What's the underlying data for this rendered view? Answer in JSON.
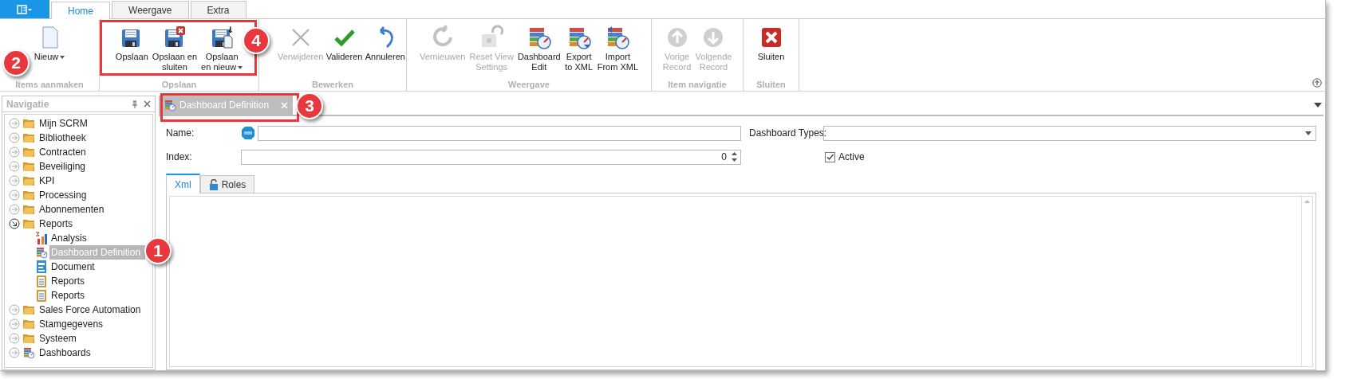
{
  "ribbon_tabs": [
    {
      "label": "Home",
      "selected": true
    },
    {
      "label": "Weergave",
      "selected": false
    },
    {
      "label": "Extra",
      "selected": false
    }
  ],
  "ribbon_groups": [
    {
      "label": "Items aanmaken",
      "buttons": [
        {
          "label": "Nieuw",
          "kind": "new",
          "disabled": false,
          "dropdown": true
        }
      ]
    },
    {
      "label": "Opslaan",
      "buttons": [
        {
          "label": "Opslaan",
          "kind": "save",
          "disabled": false,
          "dropdown": false
        },
        {
          "label": "Opslaan en\nsluiten",
          "kind": "save_close",
          "disabled": false,
          "dropdown": false
        },
        {
          "label": "Opslaan\nen nieuw",
          "kind": "save_new",
          "disabled": false,
          "dropdown": true
        }
      ]
    },
    {
      "label": "Bewerken",
      "buttons": [
        {
          "label": "Verwijderen",
          "kind": "delete",
          "disabled": true,
          "dropdown": false
        },
        {
          "label": "Valideren",
          "kind": "validate",
          "disabled": false,
          "dropdown": false
        },
        {
          "label": "Annuleren",
          "kind": "undo",
          "disabled": false,
          "dropdown": false
        }
      ]
    },
    {
      "label": "Weergave",
      "buttons": [
        {
          "label": "Vernieuwen",
          "kind": "refresh",
          "disabled": true,
          "dropdown": false
        },
        {
          "label": "Reset View\nSettings",
          "kind": "reset",
          "disabled": true,
          "dropdown": false
        },
        {
          "label": "Dashboard\nEdit",
          "kind": "dashboard",
          "disabled": false,
          "dropdown": false
        },
        {
          "label": "Export\nto XML",
          "kind": "export",
          "disabled": false,
          "dropdown": false
        },
        {
          "label": "Import\nFrom XML",
          "kind": "import",
          "disabled": false,
          "dropdown": false
        }
      ]
    },
    {
      "label": "Item navigatie",
      "buttons": [
        {
          "label": "Vorige\nRecord",
          "kind": "up",
          "disabled": true,
          "dropdown": false
        },
        {
          "label": "Volgende\nRecord",
          "kind": "down",
          "disabled": true,
          "dropdown": false
        }
      ]
    },
    {
      "label": "Sluiten",
      "buttons": [
        {
          "label": "Sluiten",
          "kind": "close",
          "disabled": false,
          "dropdown": false
        }
      ]
    }
  ],
  "navigation": {
    "title": "Navigatie",
    "items": [
      {
        "label": "Mijn SCRM",
        "kind": "folder",
        "expanded": false
      },
      {
        "label": "Bibliotheek",
        "kind": "folder",
        "expanded": false
      },
      {
        "label": "Contracten",
        "kind": "folder",
        "expanded": false
      },
      {
        "label": "Beveiliging",
        "kind": "folder",
        "expanded": false
      },
      {
        "label": "KPI",
        "kind": "folder",
        "expanded": false
      },
      {
        "label": "Processing",
        "kind": "folder",
        "expanded": false
      },
      {
        "label": "Abonnementen",
        "kind": "folder",
        "expanded": false
      },
      {
        "label": "Reports",
        "kind": "folder",
        "expanded": true,
        "children": [
          {
            "label": "Analysis",
            "kind": "chart",
            "selected": false
          },
          {
            "label": "Dashboard Definition",
            "kind": "dashboard",
            "selected": true
          },
          {
            "label": "Document",
            "kind": "document",
            "selected": false
          },
          {
            "label": "Reports",
            "kind": "clipboard",
            "selected": false
          },
          {
            "label": "Reports",
            "kind": "clipboard",
            "selected": false
          }
        ]
      },
      {
        "label": "Sales Force Automation",
        "kind": "folder",
        "expanded": false
      },
      {
        "label": "Stamgegevens",
        "kind": "folder",
        "expanded": false
      },
      {
        "label": "Systeem",
        "kind": "folder",
        "expanded": false
      },
      {
        "label": "Dashboards",
        "kind": "dashboard",
        "expanded": false
      }
    ]
  },
  "document_tab": {
    "label": "Dashboard Definition"
  },
  "form": {
    "name_label": "Name:",
    "index_label": "Index:",
    "index_value": "0",
    "types_label": "Dashboard Types:",
    "active": {
      "label": "Active",
      "checked": true
    }
  },
  "inner_tabs": [
    {
      "label": "Xml",
      "kind": "plain",
      "selected": true
    },
    {
      "label": "Roles",
      "kind": "lock",
      "selected": false
    }
  ],
  "callouts": [
    {
      "number": "1"
    },
    {
      "number": "2"
    },
    {
      "number": "3"
    },
    {
      "number": "4"
    }
  ]
}
